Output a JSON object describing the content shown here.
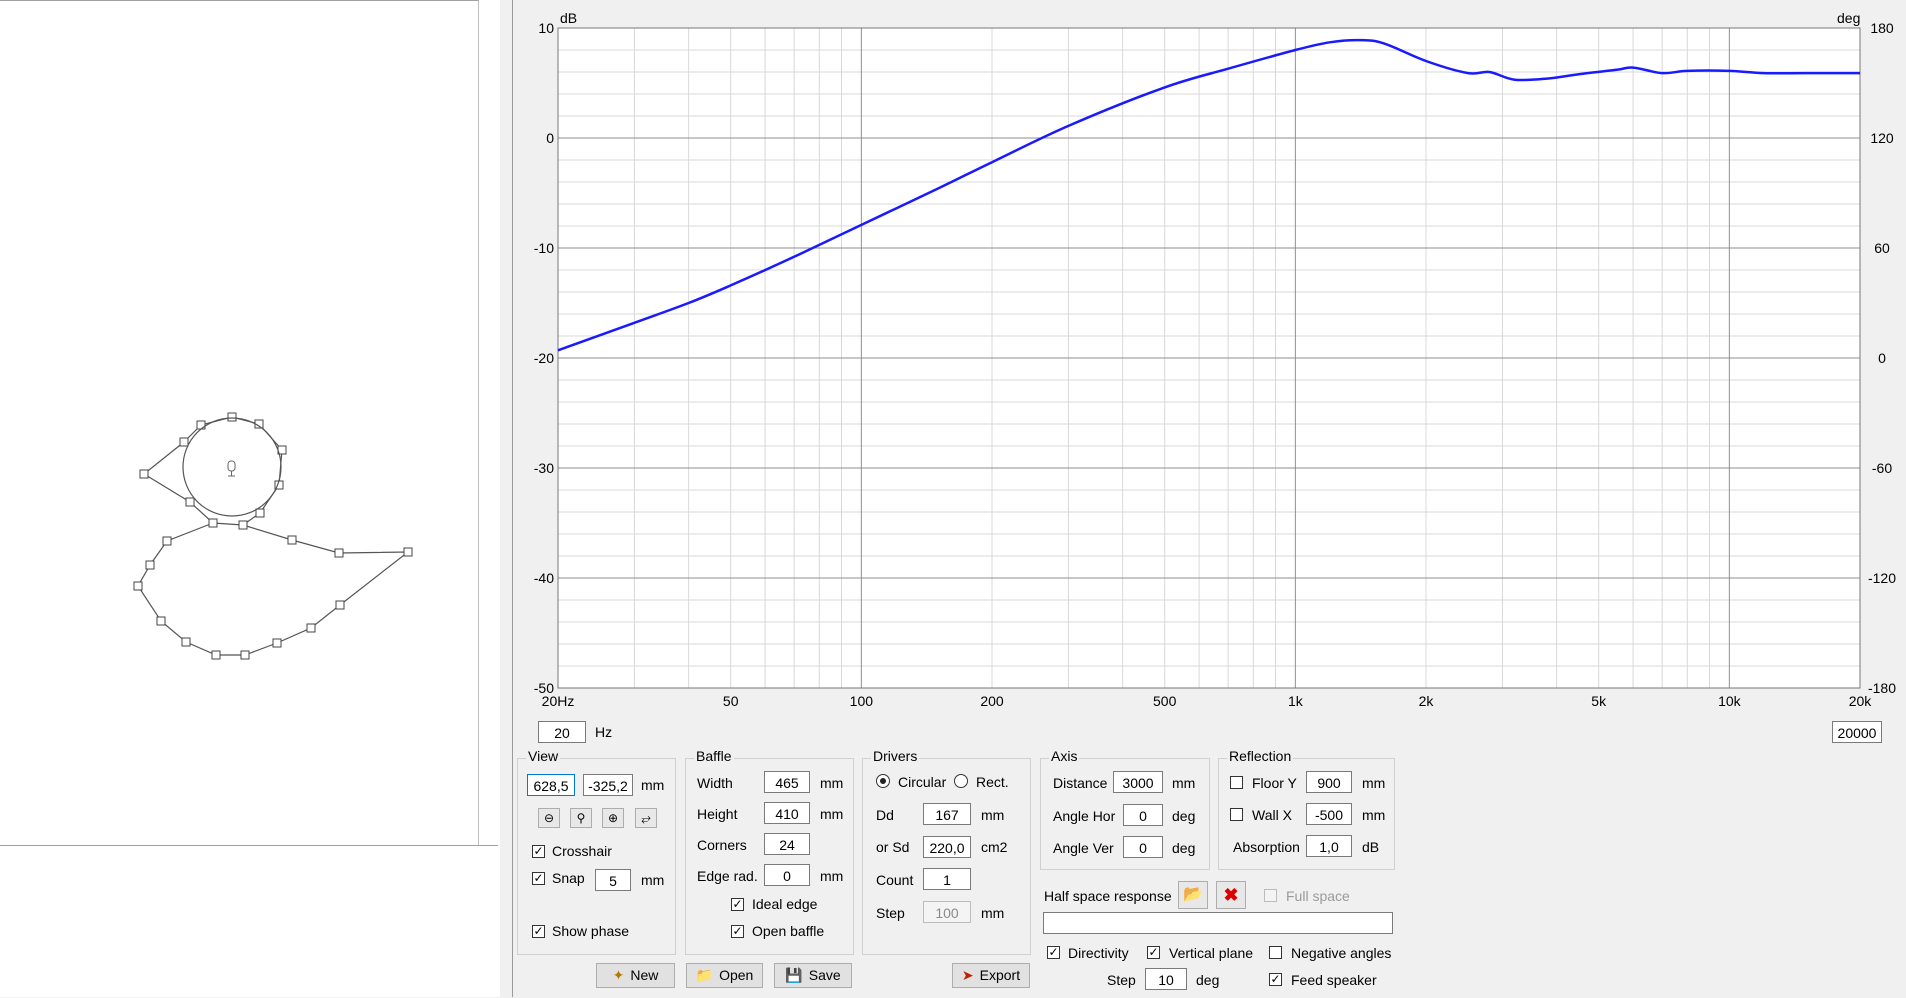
{
  "graph": {
    "db_unit": "dB",
    "deg_unit": "deg",
    "left_ticks": [
      "10",
      "0",
      "-10",
      "-20",
      "-30",
      "-40",
      "-50"
    ],
    "right_ticks": [
      "180",
      "120",
      "60",
      "0",
      "-60",
      "-120",
      "-180"
    ],
    "x_ticks": [
      "20Hz",
      "50",
      "100",
      "200",
      "500",
      "1k",
      "2k",
      "5k",
      "10k",
      "20k"
    ],
    "curve_color": "#1a1aff"
  },
  "chart_data": {
    "type": "line",
    "xscale": "log",
    "xlim": [
      20,
      20000
    ],
    "ylim": [
      -50,
      10
    ],
    "y2lim": [
      -180,
      180
    ],
    "grid": true,
    "series": [
      {
        "x": [
          20,
          30,
          40,
          50,
          70,
          100,
          150,
          200,
          300,
          500,
          700,
          1000,
          1200,
          1400,
          1600,
          2000,
          2500,
          2800,
          3200,
          3800,
          4500,
          5500,
          6000,
          7000,
          8000,
          10000,
          12000,
          15000,
          20000
        ],
        "y": [
          -19.3,
          -16.8,
          -15.0,
          -13.4,
          -10.8,
          -7.9,
          -4.6,
          -2.2,
          1.1,
          4.6,
          6.3,
          8.0,
          8.7,
          8.9,
          8.6,
          7.0,
          5.9,
          6.0,
          5.3,
          5.4,
          5.8,
          6.2,
          6.4,
          5.9,
          6.1,
          6.1,
          5.9,
          5.9,
          5.9
        ]
      }
    ]
  },
  "freq_min": {
    "value": "20",
    "unit": "Hz"
  },
  "freq_max": {
    "value": "20000"
  },
  "view": {
    "title": "View",
    "x": "628,5",
    "y": "-325,2",
    "unit": "mm",
    "tools": [
      "zoom-out-icon",
      "zoom-fit-icon",
      "zoom-in-icon",
      "fit-all-icon"
    ],
    "crosshair_label": "Crosshair",
    "snap_label": "Snap",
    "snap_value": "5",
    "snap_unit": "mm",
    "show_phase_label": "Show phase"
  },
  "baffle": {
    "title": "Baffle",
    "width_label": "Width",
    "width": "465",
    "width_unit": "mm",
    "height_label": "Height",
    "height": "410",
    "height_unit": "mm",
    "corners_label": "Corners",
    "corners": "24",
    "edge_label": "Edge rad.",
    "edge": "0",
    "edge_unit": "mm",
    "ideal_edge_label": "Ideal edge",
    "open_baffle_label": "Open baffle"
  },
  "drivers": {
    "title": "Drivers",
    "circular_label": "Circular",
    "rect_label": "Rect.",
    "dd_label": "Dd",
    "dd": "167",
    "dd_unit": "mm",
    "sd_label": "or Sd",
    "sd": "220,0",
    "sd_unit": "cm2",
    "count_label": "Count",
    "count": "1",
    "step_label": "Step",
    "step": "100",
    "step_unit": "mm"
  },
  "axis": {
    "title": "Axis",
    "distance_label": "Distance",
    "distance": "3000",
    "distance_unit": "mm",
    "angle_hor_label": "Angle Hor",
    "angle_hor": "0",
    "angle_hor_unit": "deg",
    "angle_ver_label": "Angle Ver",
    "angle_ver": "0",
    "angle_ver_unit": "deg"
  },
  "reflection": {
    "title": "Reflection",
    "floor_label": "Floor Y",
    "floor": "900",
    "floor_unit": "mm",
    "wall_label": "Wall  X",
    "wall": "-500",
    "wall_unit": "mm",
    "absorption_label": "Absorption",
    "absorption": "1,0",
    "absorption_unit": "dB"
  },
  "half_space": {
    "label": "Half space response",
    "full_space_label": "Full space",
    "file_value": ""
  },
  "bottom_opts": {
    "directivity_label": "Directivity",
    "vertical_plane_label": "Vertical plane",
    "negative_angles_label": "Negative angles",
    "step_label": "Step",
    "step": "10",
    "step_unit": "deg",
    "feed_speaker_label": "Feed speaker"
  },
  "buttons": {
    "new_label": "New",
    "open_label": "Open",
    "save_label": "Save",
    "export_label": "Export"
  }
}
